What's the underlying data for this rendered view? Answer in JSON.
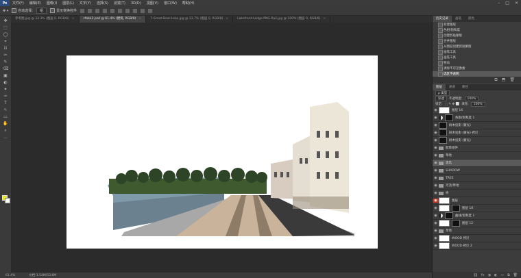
{
  "menu": {
    "logo": "Ps",
    "items": [
      "文件(F)",
      "编辑(E)",
      "图像(I)",
      "图层(L)",
      "文字(Y)",
      "选择(S)",
      "滤镜(T)",
      "3D(D)",
      "视图(V)",
      "窗口(W)",
      "帮助(H)"
    ],
    "window_controls": [
      "–",
      "□",
      "✕"
    ]
  },
  "options": {
    "auto_select_label": "自动选择:",
    "auto_select_value": "组",
    "show_transform_label": "显示变换控件"
  },
  "tabs": [
    {
      "label": "参考图.jpg @ 33.3% (图层 0, RGB/8)",
      "active": false
    },
    {
      "label": "cfekk1.psd @ 61.4% (建筑, RGB/8)",
      "active": true
    },
    {
      "label": "7-Great-Bear-Lake.jpg @ 33.7% (图层 0, RGB/8)",
      "active": false
    },
    {
      "label": "Lakefront-Lodge-PNG-Rail.jpg @ 100% (图层 0, RGB/8)",
      "active": false
    }
  ],
  "tools": [
    "✥",
    "⬚",
    "◯",
    "⌖",
    "⊡",
    "✂",
    "✎",
    "⌫",
    "▣",
    "◐",
    "✦",
    "✑",
    "T",
    "↖",
    "▭",
    "✋",
    "⌕",
    "…"
  ],
  "status": {
    "zoom": "61.4%",
    "doc": "文档:1.54M/53.6M"
  },
  "history": {
    "tabs": [
      "历史记录",
      "画笔",
      "颜色"
    ],
    "items": [
      "新建图层",
      "色相/饱和度",
      "创建剪贴蒙版",
      "合并图层",
      "从图层创建剪贴蒙版",
      "画笔工具",
      "画笔工具",
      "移动",
      "清除不可见像素",
      "选区不透明"
    ],
    "current_index": 9,
    "footer_icons": [
      "⧉",
      "⬒",
      "🗑"
    ]
  },
  "layers": {
    "tabs": [
      "图层",
      "通道",
      "路径"
    ],
    "kind_label": "ρ 类型",
    "blend_mode": "穿透",
    "opacity_label": "不透明度:",
    "opacity_value": "100%",
    "lock_label": "锁定:",
    "fill_label": "填充:",
    "fill_value": "100%",
    "items": [
      {
        "name": "图层 16",
        "type": "thumb"
      },
      {
        "name": "色相/饱和度 1",
        "type": "adj"
      },
      {
        "name": "树木投影 (蒙光)",
        "type": "mask"
      },
      {
        "name": "树木投影 (蒙光) 拷贝",
        "type": "mask"
      },
      {
        "name": "树木投影 (蒙光)",
        "type": "mask"
      },
      {
        "name": "配景组件",
        "type": "folder"
      },
      {
        "name": "草地",
        "type": "folder"
      },
      {
        "name": "建筑",
        "type": "folder",
        "selected": true
      },
      {
        "name": "SHADOW",
        "type": "folder"
      },
      {
        "name": "TREE",
        "type": "folder"
      },
      {
        "name": "河流/草地",
        "type": "folder"
      },
      {
        "name": "桥",
        "type": "folder"
      },
      {
        "name": "图层",
        "type": "thumb",
        "red": true
      },
      {
        "name": "图层 18",
        "type": "mask"
      },
      {
        "name": "曲线/饱和度 1",
        "type": "adj"
      },
      {
        "name": "图层 12",
        "type": "mask"
      },
      {
        "name": "草地",
        "type": "folder"
      },
      {
        "name": "WOOD 拷贝",
        "type": "thumb"
      },
      {
        "name": "WOOD 拷贝 2",
        "type": "thumb"
      }
    ],
    "footer_icons": [
      "⛓",
      "fx",
      "◑",
      "◐",
      "▭",
      "⧉",
      "🗑"
    ]
  }
}
